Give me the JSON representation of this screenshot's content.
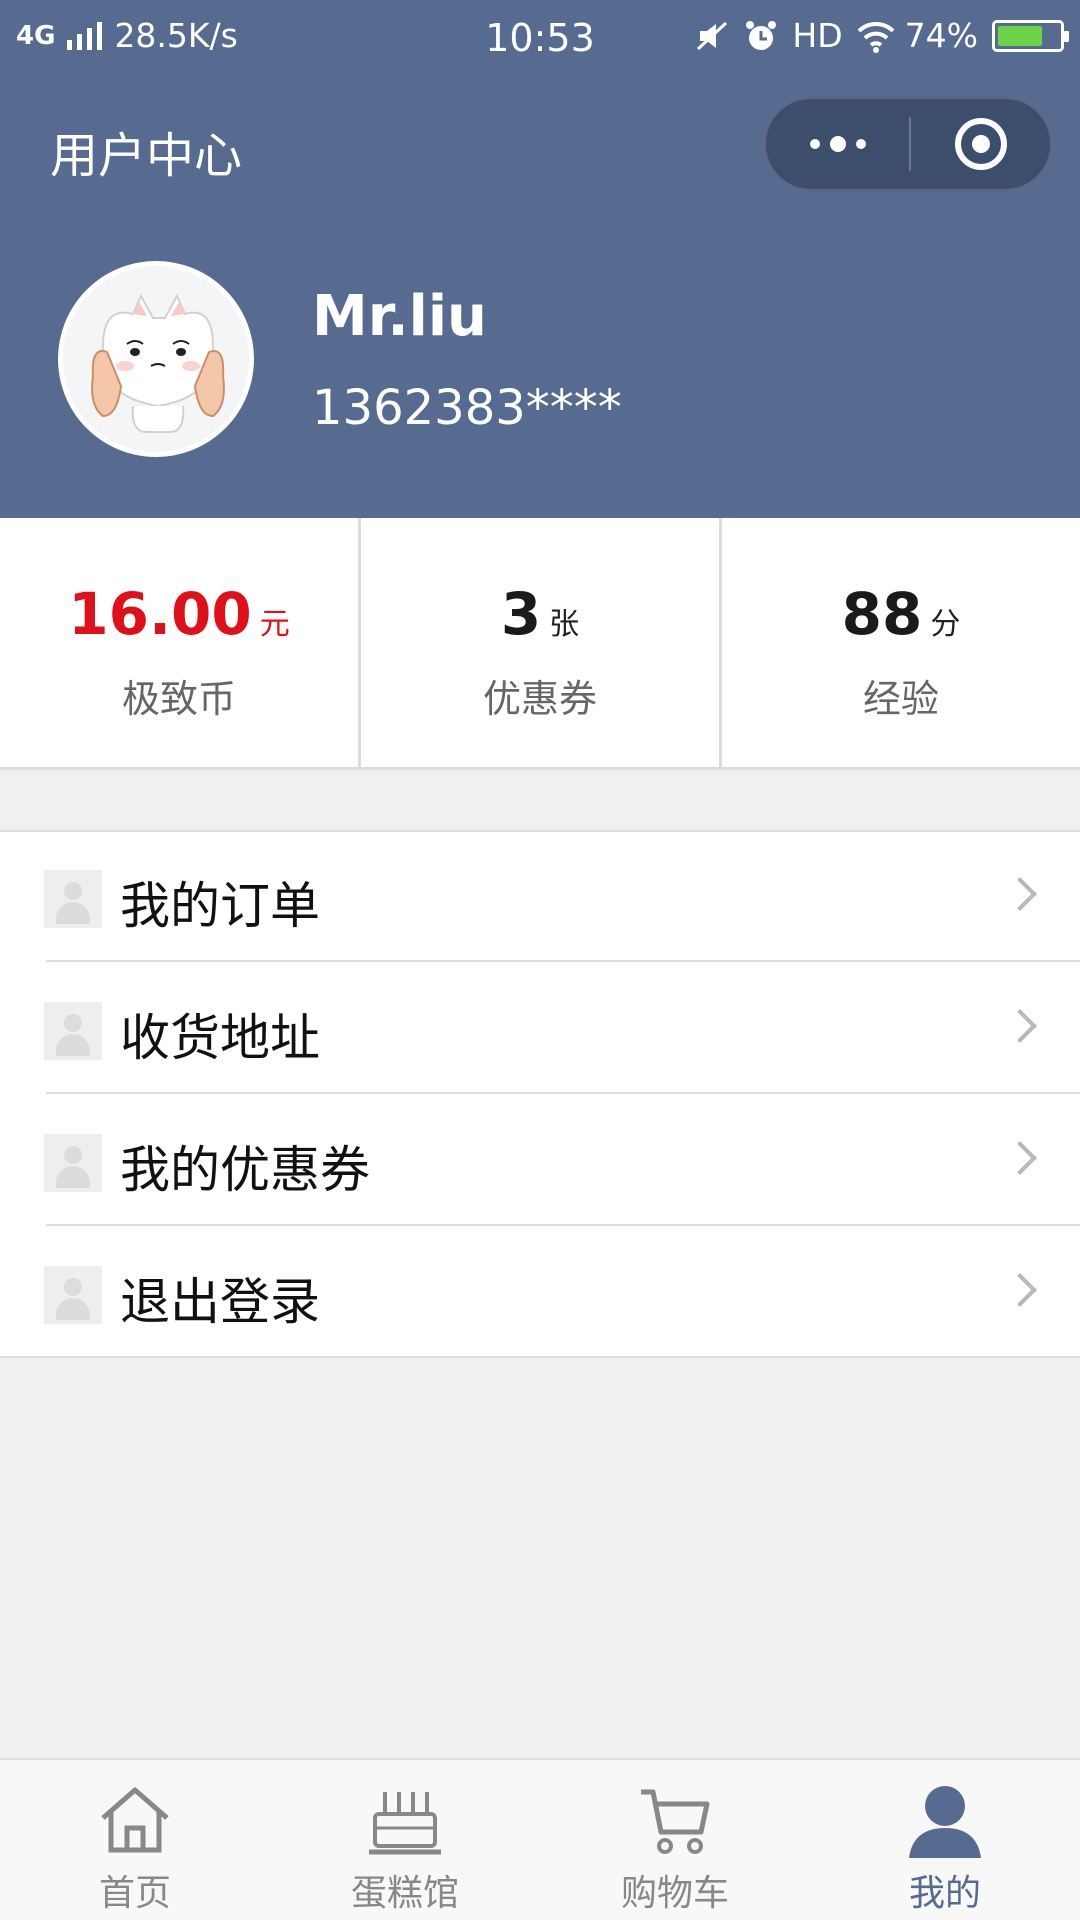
{
  "status_bar": {
    "network": "4G",
    "speed": "28.5K/s",
    "time": "10:53",
    "hd": "HD",
    "battery": "74%",
    "battery_level": 0.74
  },
  "header": {
    "title": "用户中心",
    "background_color": "#576b91"
  },
  "profile": {
    "name": "Mr.liu",
    "phone": "1362383****"
  },
  "stats": [
    {
      "value": "16.00",
      "unit": "元",
      "label": "极致币",
      "color": "#e0101a"
    },
    {
      "value": "3",
      "unit": "张",
      "label": "优惠券"
    },
    {
      "value": "88",
      "unit": "分",
      "label": "经验"
    }
  ],
  "menu": [
    {
      "label": "我的订单",
      "icon": "user-placeholder-icon"
    },
    {
      "label": "收货地址",
      "icon": "user-placeholder-icon"
    },
    {
      "label": "我的优惠券",
      "icon": "user-placeholder-icon"
    },
    {
      "label": "退出登录",
      "icon": "user-placeholder-icon"
    }
  ],
  "tabs": [
    {
      "label": "首页",
      "icon": "home-icon",
      "active": false
    },
    {
      "label": "蛋糕馆",
      "icon": "cake-icon",
      "active": false
    },
    {
      "label": "购物车",
      "icon": "cart-icon",
      "active": false
    },
    {
      "label": "我的",
      "icon": "person-icon",
      "active": true
    }
  ],
  "colors": {
    "accent": "#576b91",
    "price_red": "#e0101a",
    "page_bg": "#f1f0f0"
  }
}
